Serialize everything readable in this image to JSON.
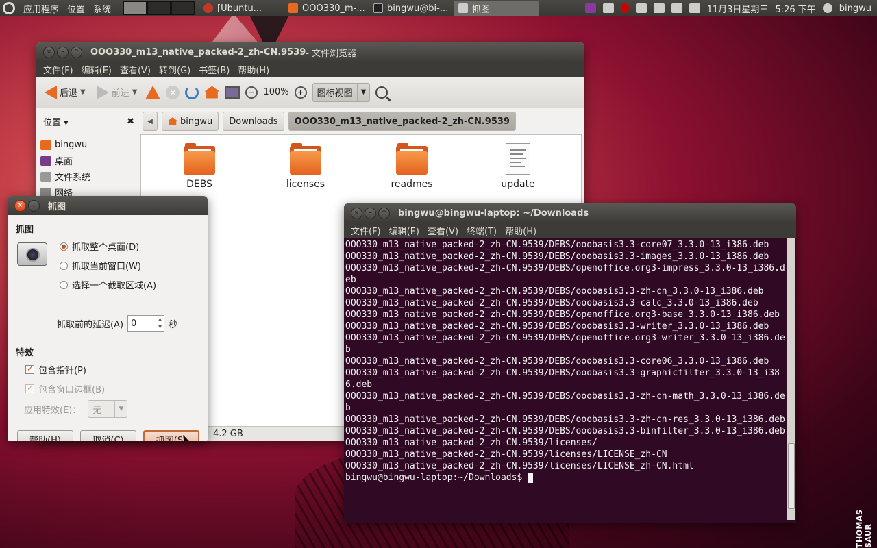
{
  "panel": {
    "menus": [
      "应用程序",
      "位置",
      "系统"
    ],
    "tasks": [
      {
        "label": "[Ubuntu...",
        "icon": "browser-icon",
        "active": false
      },
      {
        "label": "OOO330_m-...",
        "icon": "folder-icon",
        "active": false
      },
      {
        "label": "bingwu@bi-...",
        "icon": "terminal-icon",
        "active": false
      },
      {
        "label": "抓图",
        "icon": "camera-icon",
        "active": true
      }
    ],
    "datetime": "11月3日星期三",
    "time": "5:26 下午",
    "user": "bingwu"
  },
  "desktop": {
    "watermark": "THOMAS SAUR"
  },
  "file_browser": {
    "title": "OOO330_m13_native_packed-2_zh-CN.9539",
    "title_suffix": " - 文件浏览器",
    "menu": [
      "文件(F)",
      "编辑(E)",
      "查看(V)",
      "转到(G)",
      "书签(B)",
      "帮助(H)"
    ],
    "toolbar": {
      "back": "后退",
      "forward": "前进",
      "zoom": "100%",
      "view": "图标视图"
    },
    "sidebar_header": "位置",
    "breadcrumbs": [
      "bingwu",
      "Downloads",
      "OOO330_m13_native_packed-2_zh-CN.9539"
    ],
    "sidebar": [
      "bingwu",
      "桌面",
      "文件系统",
      "网络"
    ],
    "files": [
      {
        "name": "DEBS",
        "type": "folder"
      },
      {
        "name": "licenses",
        "type": "folder"
      },
      {
        "name": "readmes",
        "type": "folder"
      },
      {
        "name": "update",
        "type": "file"
      }
    ],
    "status": "4.2 GB"
  },
  "screenshot_dialog": {
    "title": "抓图",
    "section_capture": "抓图",
    "options": [
      {
        "label": "抓取整个桌面(D)",
        "selected": true
      },
      {
        "label": "抓取当前窗口(W)",
        "selected": false
      },
      {
        "label": "选择一个截取区域(A)",
        "selected": false
      }
    ],
    "delay_label": "抓取前的延迟(A)",
    "delay_value": "0",
    "delay_unit": "秒",
    "section_effects": "特效",
    "include_pointer": "包含指针(P)",
    "include_border": "包含窗口边框(B)",
    "effect_label": "应用特效(E)：",
    "effect_value": "无",
    "buttons": {
      "help": "帮助(H)",
      "cancel": "取消(C)",
      "capture": "抓图(S)"
    }
  },
  "terminal": {
    "title": "bingwu@bingwu-laptop: ~/Downloads",
    "menu": [
      "文件(F)",
      "编辑(E)",
      "查看(V)",
      "终端(T)",
      "帮助(H)"
    ],
    "lines": [
      "OOO330_m13_native_packed-2_zh-CN.9539/DEBS/ooobasis3.3-core07_3.3.0-13_i386.deb",
      "OOO330_m13_native_packed-2_zh-CN.9539/DEBS/ooobasis3.3-images_3.3.0-13_i386.deb",
      "OOO330_m13_native_packed-2_zh-CN.9539/DEBS/openoffice.org3-impress_3.3.0-13_i386.deb",
      "OOO330_m13_native_packed-2_zh-CN.9539/DEBS/ooobasis3.3-zh-cn_3.3.0-13_i386.deb",
      "OOO330_m13_native_packed-2_zh-CN.9539/DEBS/ooobasis3.3-calc_3.3.0-13_i386.deb",
      "OOO330_m13_native_packed-2_zh-CN.9539/DEBS/openoffice.org3-base_3.3.0-13_i386.deb",
      "OOO330_m13_native_packed-2_zh-CN.9539/DEBS/ooobasis3.3-writer_3.3.0-13_i386.deb",
      "OOO330_m13_native_packed-2_zh-CN.9539/DEBS/openoffice.org3-writer_3.3.0-13_i386.deb",
      "OOO330_m13_native_packed-2_zh-CN.9539/DEBS/ooobasis3.3-core06_3.3.0-13_i386.deb",
      "OOO330_m13_native_packed-2_zh-CN.9539/DEBS/ooobasis3.3-graphicfilter_3.3.0-13_i386.deb",
      "OOO330_m13_native_packed-2_zh-CN.9539/DEBS/ooobasis3.3-zh-cn-math_3.3.0-13_i386.deb",
      "OOO330_m13_native_packed-2_zh-CN.9539/DEBS/ooobasis3.3-zh-cn-res_3.3.0-13_i386.deb",
      "OOO330_m13_native_packed-2_zh-CN.9539/DEBS/ooobasis3.3-binfilter_3.3.0-13_i386.deb",
      "OOO330_m13_native_packed-2_zh-CN.9539/licenses/",
      "OOO330_m13_native_packed-2_zh-CN.9539/licenses/LICENSE_zh-CN",
      "OOO330_m13_native_packed-2_zh-CN.9539/licenses/LICENSE_zh-CN.html"
    ],
    "prompt": "bingwu@bingwu-laptop:~/Downloads$ "
  }
}
